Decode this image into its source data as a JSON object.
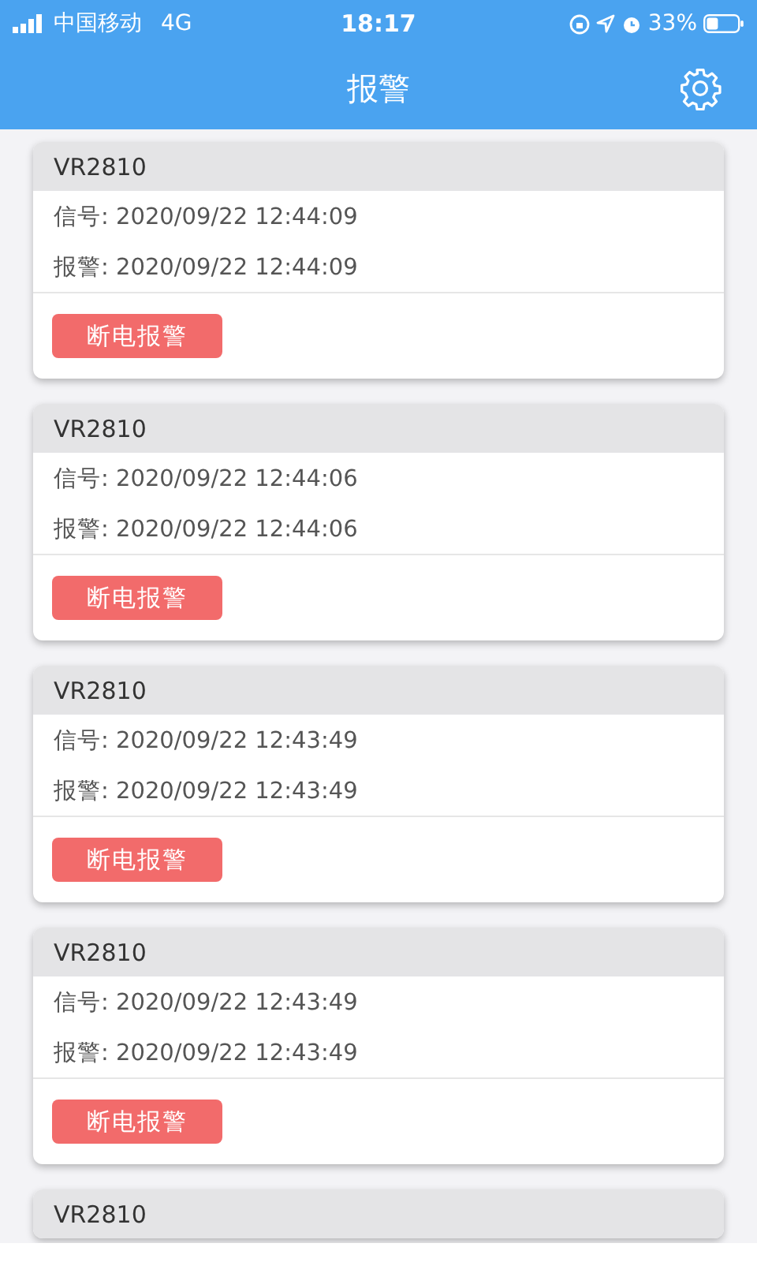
{
  "status_bar": {
    "carrier": "中国移动",
    "network": "4G",
    "time": "18:17",
    "battery": "33%"
  },
  "nav": {
    "title": "报警"
  },
  "alarms": [
    {
      "device": "VR2810",
      "lines": [
        "信号: 2020/09/22 12:44:09",
        "报警: 2020/09/22 12:44:09"
      ],
      "action": "断电报警"
    },
    {
      "device": "VR2810",
      "lines": [
        "信号: 2020/09/22 12:44:06",
        "报警: 2020/09/22 12:44:06"
      ],
      "action": "断电报警"
    },
    {
      "device": "VR2810",
      "lines": [
        "信号: 2020/09/22 12:43:49",
        "报警: 2020/09/22 12:43:49"
      ],
      "action": "断电报警"
    },
    {
      "device": "VR2810",
      "lines": [
        "信号: 2020/09/22 12:43:49",
        "报警: 2020/09/22 12:43:49"
      ],
      "action": "断电报警"
    },
    {
      "device": "VR2810"
    }
  ]
}
